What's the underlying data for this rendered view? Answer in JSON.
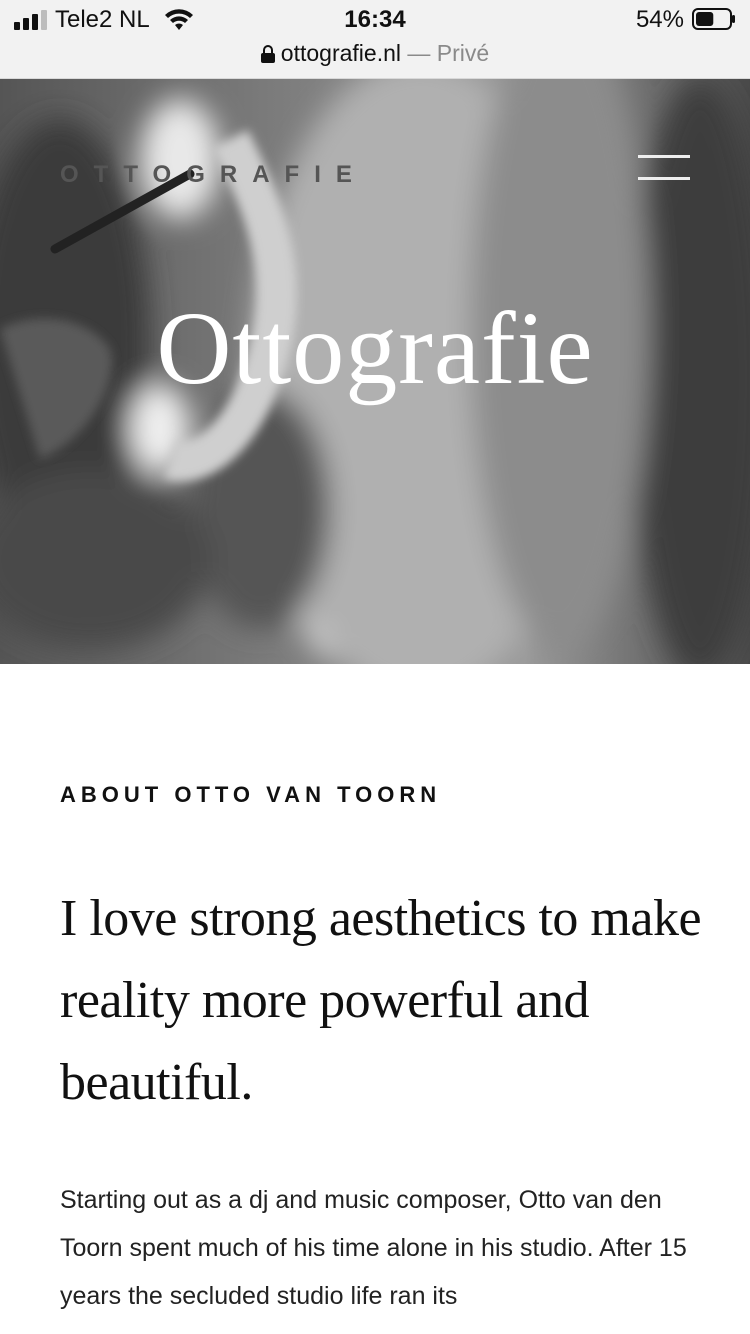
{
  "status_bar": {
    "carrier": "Tele2 NL",
    "time": "16:34",
    "battery_percent": "54%",
    "battery_level": 0.54
  },
  "url_bar": {
    "domain": "ottografie.nl",
    "mode": "— Privé"
  },
  "header": {
    "logo": "OTTOGRAFIE",
    "menu_icon": "hamburger-icon"
  },
  "hero": {
    "title": "Ottografie"
  },
  "about": {
    "label": "ABOUT OTTO VAN TOORN",
    "headline": "I love strong aesthetics to make reality more powerful and beautiful.",
    "body": "Starting out as a dj and music composer, Otto van den Toorn spent much of his time alone in his studio. After 15 years the secluded studio life ran its"
  }
}
